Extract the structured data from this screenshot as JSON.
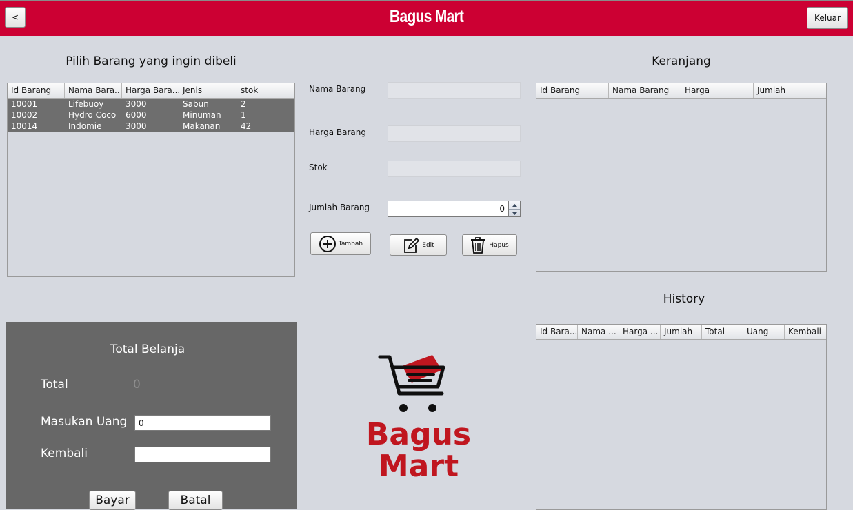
{
  "header": {
    "back_label": "<",
    "title": "Bagus Mart",
    "exit_label": "Keluar"
  },
  "products": {
    "title": "Pilih Barang yang ingin dibeli",
    "columns": [
      "Id Barang",
      "Nama Bara...",
      "Harga Bara...",
      "Jenis",
      "stok"
    ],
    "rows": [
      [
        "10001",
        "Lifebuoy",
        "3000",
        "Sabun",
        "2"
      ],
      [
        "10002",
        "Hydro Coco",
        "6000",
        "Minuman",
        "1"
      ],
      [
        "10014",
        "Indomie",
        "3000",
        "Makanan",
        "42"
      ]
    ]
  },
  "form": {
    "nama_label": "Nama Barang",
    "harga_label": "Harga Barang",
    "stok_label": "Stok",
    "jumlah_label": "Jumlah Barang",
    "jumlah_value": "0",
    "tambah_label": "Tambah",
    "edit_label": "Edit",
    "hapus_label": "Hapus"
  },
  "cart": {
    "title": "Keranjang",
    "columns": [
      "Id Barang",
      "Nama Barang",
      "Harga",
      "Jumlah"
    ]
  },
  "history": {
    "title": "History",
    "columns": [
      "Id Bara...",
      "Nama ...",
      "Harga ...",
      "Jumlah",
      "Total",
      "Uang",
      "Kembali"
    ]
  },
  "payment": {
    "title": "Total Belanja",
    "total_label": "Total",
    "total_value": "0",
    "uang_label": "Masukan Uang",
    "uang_value": "0",
    "kembali_label": "Kembali",
    "kembali_value": "",
    "bayar_label": "Bayar",
    "batal_label": "Batal"
  },
  "logo": {
    "line1": "Bagus",
    "line2": "Mart",
    "icon": "shopping-cart-icon"
  },
  "colors": {
    "brand": "#cc0033",
    "logo_red": "#c0161f",
    "row_selected": "#6e6e6e",
    "panel": "#676767"
  }
}
